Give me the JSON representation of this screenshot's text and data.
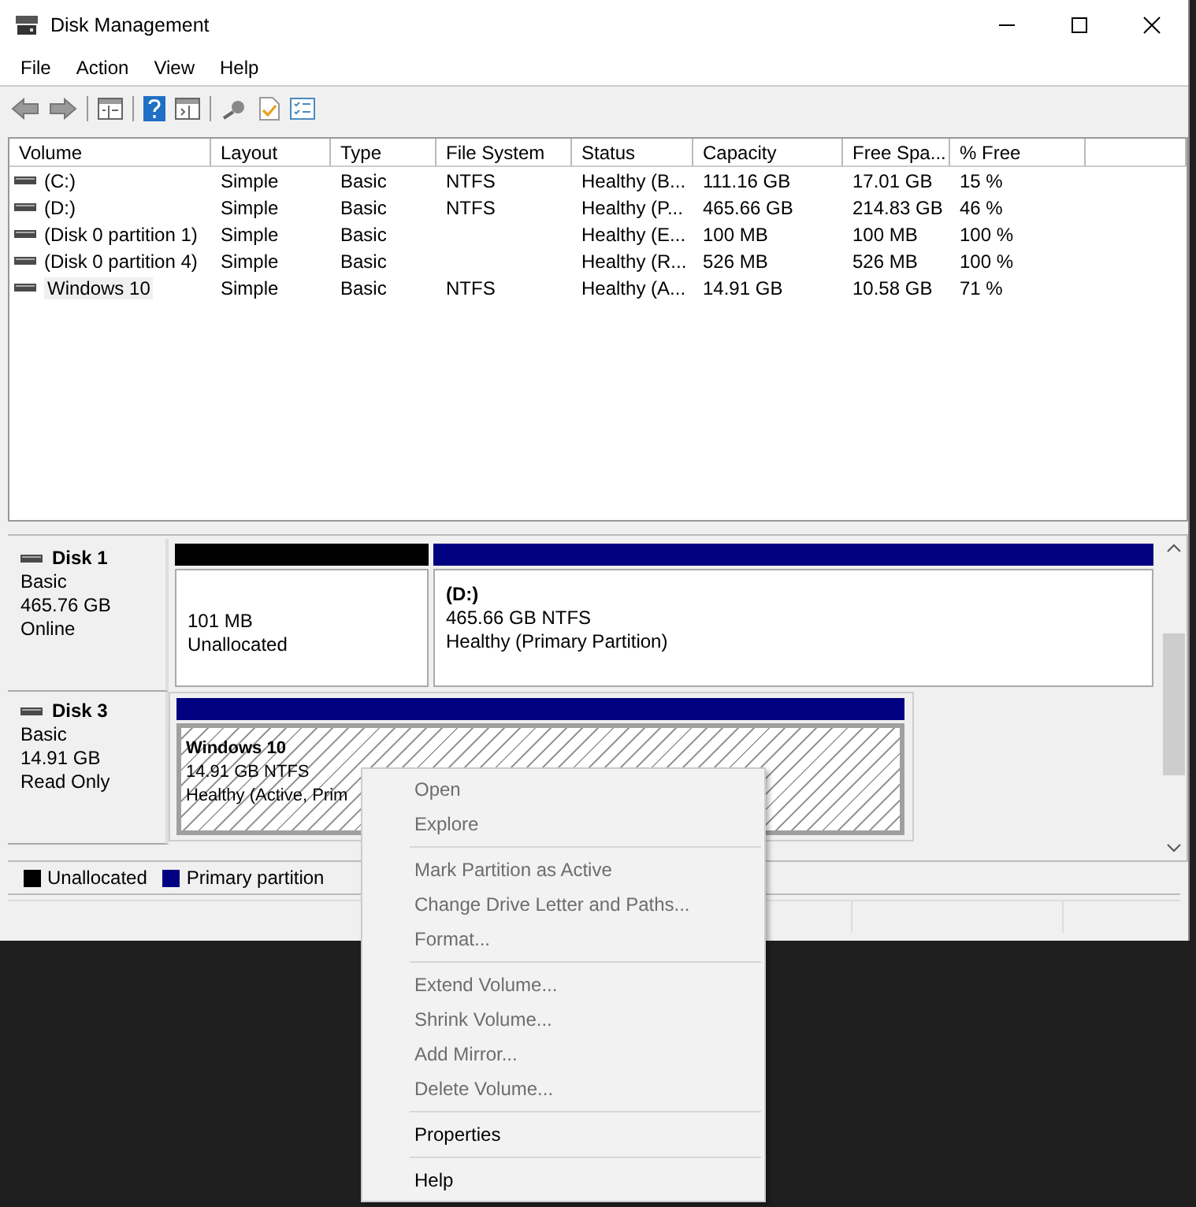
{
  "window": {
    "title": "Disk Management"
  },
  "menu_bar": [
    "File",
    "Action",
    "View",
    "Help"
  ],
  "volume_table": {
    "columns": [
      "Volume",
      "Layout",
      "Type",
      "File System",
      "Status",
      "Capacity",
      "Free Spa...",
      "% Free"
    ],
    "rows": [
      {
        "selected": false,
        "cells": [
          "(C:)",
          "Simple",
          "Basic",
          "NTFS",
          "Healthy (B...",
          "111.16 GB",
          "17.01 GB",
          "15 %"
        ]
      },
      {
        "selected": false,
        "cells": [
          "(D:)",
          "Simple",
          "Basic",
          "NTFS",
          "Healthy (P...",
          "465.66 GB",
          "214.83 GB",
          "46 %"
        ]
      },
      {
        "selected": false,
        "cells": [
          "(Disk 0 partition 1)",
          "Simple",
          "Basic",
          "",
          "Healthy (E...",
          "100 MB",
          "100 MB",
          "100 %"
        ]
      },
      {
        "selected": false,
        "cells": [
          "(Disk 0 partition 4)",
          "Simple",
          "Basic",
          "",
          "Healthy (R...",
          "526 MB",
          "526 MB",
          "100 %"
        ]
      },
      {
        "selected": true,
        "cells": [
          "Windows 10",
          "Simple",
          "Basic",
          "NTFS",
          "Healthy (A...",
          "14.91 GB",
          "10.58 GB",
          "71 %"
        ]
      }
    ]
  },
  "disks": [
    {
      "name": "Disk 1",
      "type": "Basic",
      "size": "465.76 GB",
      "status": "Online",
      "partitions": [
        {
          "kind": "unallocated",
          "selected": false,
          "lines": [
            "101 MB",
            "Unallocated"
          ]
        },
        {
          "kind": "primary",
          "selected": false,
          "title": "(D:)",
          "lines": [
            "465.66 GB NTFS",
            "Healthy (Primary Partition)"
          ]
        }
      ]
    },
    {
      "name": "Disk 3",
      "type": "Basic",
      "size": "14.91 GB",
      "status": "Read Only",
      "partitions": [
        {
          "kind": "primary",
          "selected": true,
          "title": "Windows 10",
          "lines": [
            "14.91 GB NTFS",
            "Healthy (Active, Prim"
          ]
        }
      ]
    }
  ],
  "legend": [
    {
      "label": "Unallocated",
      "color": "#000000"
    },
    {
      "label": "Primary partition",
      "color": "#000080"
    }
  ],
  "context_menu": [
    [
      {
        "label": "Open",
        "disabled": true
      },
      {
        "label": "Explore",
        "disabled": true
      }
    ],
    [
      {
        "label": "Mark Partition as Active",
        "disabled": true
      },
      {
        "label": "Change Drive Letter and Paths...",
        "disabled": true
      },
      {
        "label": "Format...",
        "disabled": true
      }
    ],
    [
      {
        "label": "Extend Volume...",
        "disabled": true
      },
      {
        "label": "Shrink Volume...",
        "disabled": true
      },
      {
        "label": "Add Mirror...",
        "disabled": true
      },
      {
        "label": "Delete Volume...",
        "disabled": true
      }
    ],
    [
      {
        "label": "Properties",
        "disabled": false
      }
    ],
    [
      {
        "label": "Help",
        "disabled": false
      }
    ]
  ]
}
